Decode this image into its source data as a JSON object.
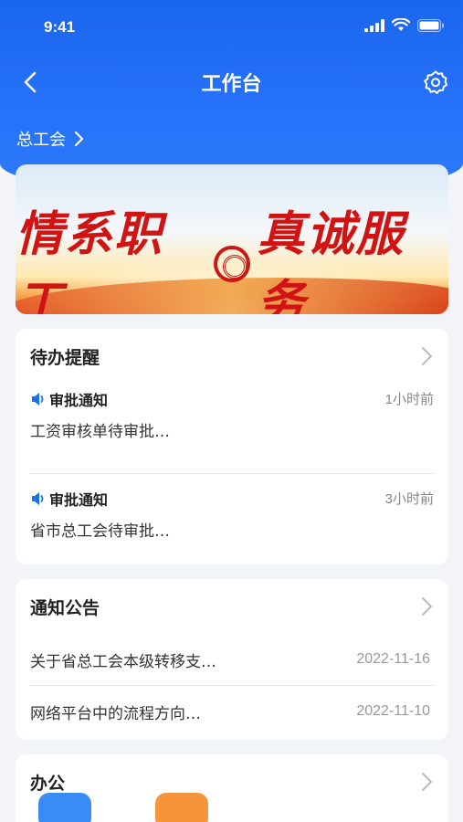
{
  "status_bar": {
    "time": "9:41"
  },
  "nav": {
    "title": "工作台"
  },
  "org": {
    "name": "总工会"
  },
  "banner": {
    "left_text": "情系职工",
    "right_text": "真诚服务"
  },
  "todo": {
    "title": "待办提醒",
    "items": [
      {
        "label": "审批通知",
        "time": "1小时前",
        "desc": "工资审核单待审批…"
      },
      {
        "label": "审批通知",
        "time": "3小时前",
        "desc": "省市总工会待审批…"
      }
    ]
  },
  "notices": {
    "title": "通知公告",
    "items": [
      {
        "title": "关于省总工会本级转移支…",
        "date": "2022-11-16"
      },
      {
        "title": "网络平台中的流程方向…",
        "date": "2022-11-10"
      }
    ]
  },
  "office": {
    "title": "办公",
    "icons": [
      {
        "name": "office-app-icon-1",
        "color": "#3a8cf5"
      },
      {
        "name": "office-app-icon-2",
        "color": "#f5943a"
      }
    ]
  },
  "colors": {
    "primary": "#1b66ee",
    "speaker": "#1a73e8"
  }
}
